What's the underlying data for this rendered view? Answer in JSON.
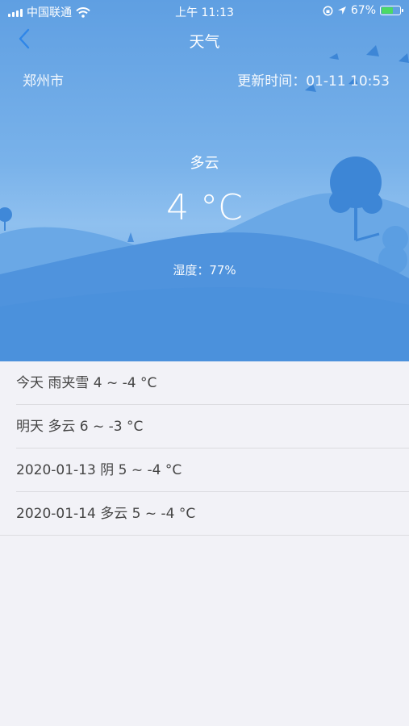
{
  "status_bar": {
    "carrier": "中国联通",
    "time": "上午 11:13",
    "battery": "67%",
    "battery_level": 0.67,
    "icons": [
      "signal-icon",
      "wifi-icon",
      "orientation-lock-icon",
      "location-icon",
      "battery-icon"
    ]
  },
  "nav": {
    "title": "天气",
    "back_icon": "chevron-left-icon"
  },
  "header": {
    "city": "郑州市",
    "update_time": "更新时间：01-11 10:53"
  },
  "current": {
    "condition": "多云",
    "temperature": "4 °C",
    "humidity": "湿度：77%"
  },
  "forecast": [
    {
      "text": "今天 雨夹雪 4 ~ -4 °C"
    },
    {
      "text": "明天 多云 6 ~ -3 °C"
    },
    {
      "text": "2020-01-13 阴 5 ~ -4 °C"
    },
    {
      "text": "2020-01-14 多云 5 ~ -4 °C"
    }
  ],
  "colors": {
    "accent": "#4a90e2",
    "hero_top": "#5f9fe2",
    "hero_bottom": "#4a90e2"
  }
}
